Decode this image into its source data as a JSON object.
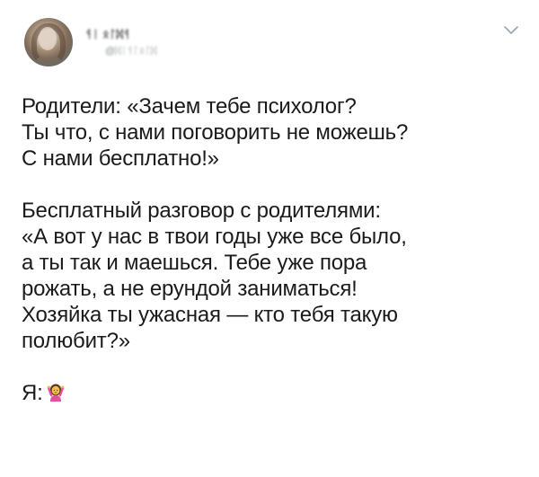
{
  "author": {
    "display_name": "ᛩᛁ ᛟᛚᛞᛩ",
    "handle": "@ᛞᛁᛩᛚᛟᛚᛞ",
    "avatar_icon": "avatar-photo",
    "menu_icon": "chevron-down-icon"
  },
  "tweet": {
    "paragraph1": "Родители: «Зачем тебе психолог?\nТы что, с нами поговорить не можешь?\nС нами бесплатно!»",
    "paragraph2": "Бесплатный разговор с родителями:\n«А вот у нас в твои годы уже все было,\nа ты так и маешься. Тебе уже пора\nрожать, а не ерундой заниматься!\nХозяйка ты ужасная — кто тебя такую\nполюбит?»",
    "paragraph3": "Я:",
    "emoji": "woman-shrugging-emoji"
  },
  "colors": {
    "text": "#1b1b1b",
    "muted": "#8a8f93",
    "chevron": "#9aa4ac",
    "emoji_skin": "#f4c24b",
    "emoji_shirt": "#e0529c"
  }
}
